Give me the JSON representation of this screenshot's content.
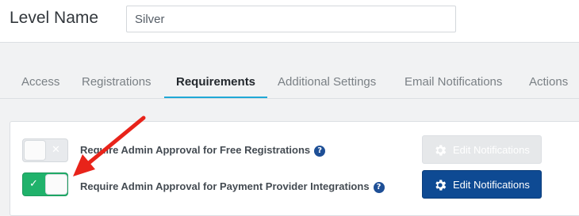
{
  "header": {
    "label": "Level Name",
    "input_value": "Silver"
  },
  "tabs": [
    {
      "label": "Access"
    },
    {
      "label": "Registrations"
    },
    {
      "label": "Requirements",
      "active": true
    },
    {
      "label": "Additional Settings"
    },
    {
      "label": "Email Notifications"
    },
    {
      "label": "Actions"
    }
  ],
  "requirements": [
    {
      "label": "Require Admin Approval for Free Registrations",
      "enabled": false,
      "button_label": "Edit Notifications",
      "button_disabled": true
    },
    {
      "label": "Require Admin Approval for Payment Provider Integrations",
      "enabled": true,
      "button_label": "Edit Notifications",
      "button_disabled": false
    }
  ],
  "icons": {
    "check": "✓",
    "cross": "✕",
    "help": "?"
  },
  "colors": {
    "toggle_on": "#20b26b",
    "primary_button": "#0e4a93",
    "active_tab_underline": "#1fa8d6",
    "annotation_arrow": "#e8231a"
  }
}
